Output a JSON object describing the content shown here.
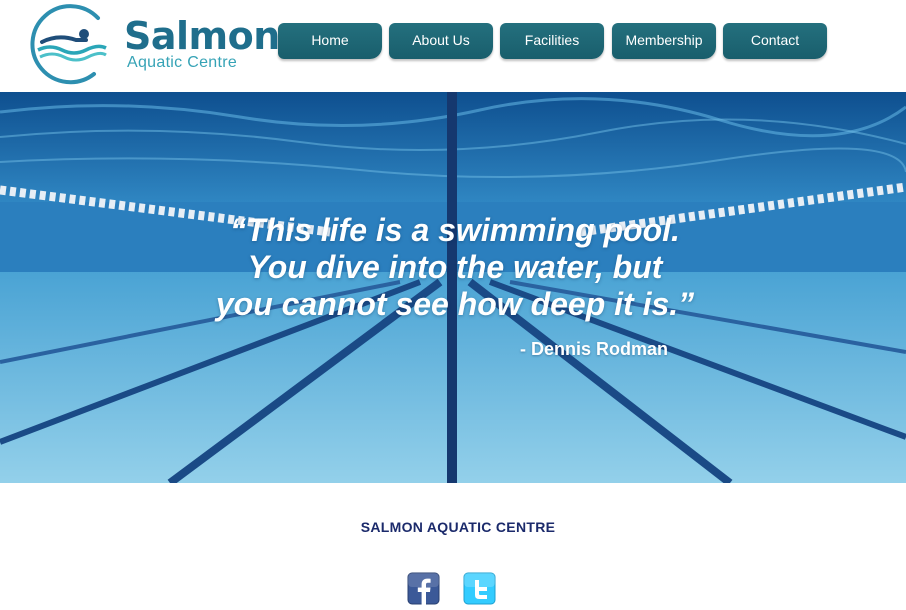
{
  "brand": {
    "name": "Salmon",
    "subtitle": "Aquatic Centre"
  },
  "nav": {
    "items": [
      {
        "label": "Home"
      },
      {
        "label": "About Us"
      },
      {
        "label": "Facilities"
      },
      {
        "label": "Membership"
      },
      {
        "label": "Contact"
      }
    ]
  },
  "hero": {
    "quote_lines": [
      "“This life is a swimming pool.",
      "You dive into the water, but",
      "you cannot see how deep it is.”"
    ],
    "author": "- Dennis Rodman"
  },
  "footer": {
    "title": "SALMON AQUATIC CENTRE",
    "social": [
      {
        "icon": "facebook-icon"
      },
      {
        "icon": "twitter-icon"
      }
    ]
  },
  "colors": {
    "brand_dark": "#1f6e8c",
    "brand_light": "#36a3b6",
    "nav_bg": "#1d6674",
    "footer_title": "#1b2a6b"
  }
}
